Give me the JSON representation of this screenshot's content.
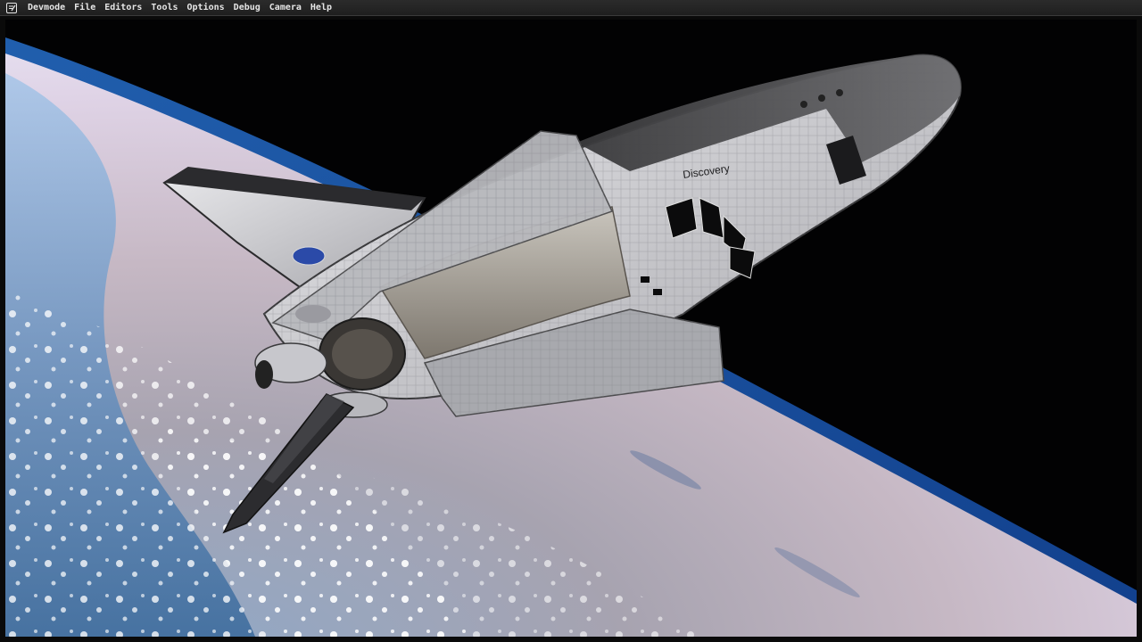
{
  "window": {
    "app_icon": "devmode-notepad-icon",
    "menu": [
      {
        "label": "Devmode"
      },
      {
        "label": "File"
      },
      {
        "label": "Editors"
      },
      {
        "label": "Tools"
      },
      {
        "label": "Options"
      },
      {
        "label": "Debug"
      },
      {
        "label": "Camera"
      },
      {
        "label": "Help"
      }
    ]
  },
  "viewport": {
    "scene": "space-shuttle-orbit-view",
    "shuttle_name": "Discovery",
    "colors": {
      "space": "#020202",
      "atmosphere_glow": "#4aa3ff",
      "ocean": "#3f6d9e",
      "land": "#b9a8a6",
      "shuttle_tiles": "#d9d9db",
      "shuttle_dark": "#2a2a2c"
    }
  }
}
